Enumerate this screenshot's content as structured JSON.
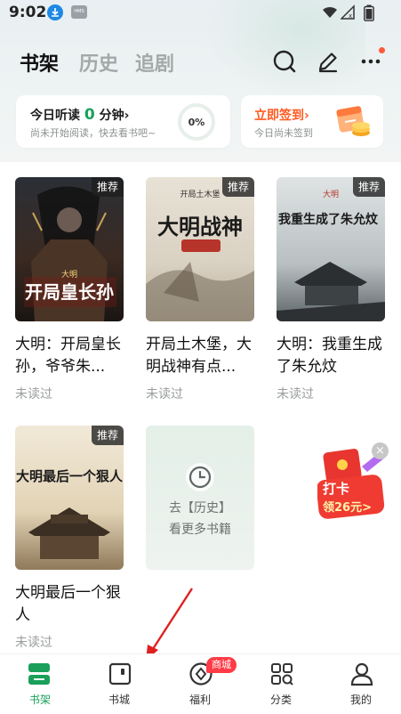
{
  "status_bar": {
    "time": "9:02",
    "hms_label": "HMS"
  },
  "header": {
    "tabs": [
      {
        "label": "书架",
        "active": true
      },
      {
        "label": "历史",
        "active": false
      },
      {
        "label": "追剧",
        "active": false
      }
    ],
    "icons": [
      "search-icon",
      "edit-icon",
      "more-icon"
    ]
  },
  "listen_card": {
    "title_prefix": "今日听读",
    "minutes": "0",
    "title_suffix": "分钟",
    "chevron": "›",
    "subtitle": "尚未开始阅读，快去看书吧~",
    "progress": "0%"
  },
  "sign_card": {
    "title": "立即签到",
    "chevron": "›",
    "subtitle": "今日尚未签到"
  },
  "books": [
    {
      "tag": "推荐",
      "title": "大明：开局皇长孙，爷爷朱...",
      "status": "未读过",
      "cover_text": "开局皇长孙",
      "cover_sub": "大明"
    },
    {
      "tag": "推荐",
      "title": "开局土木堡，大明战神有点...",
      "status": "未读过",
      "cover_text": "大明战神",
      "cover_sub": "开局土木堡"
    },
    {
      "tag": "推荐",
      "title": "大明：我重生成了朱允炆",
      "status": "未读过",
      "cover_text": "我重生成了朱允炆",
      "cover_sub": "大明"
    },
    {
      "tag": "推荐",
      "title": "大明最后一个狠人",
      "status": "未读过",
      "cover_text": "大明最后一个狠人",
      "cover_sub": ""
    }
  ],
  "history_card": {
    "line1": "去【历史】",
    "line2": "看更多书籍"
  },
  "checkin_float": {
    "label": "打卡",
    "amount": "领26元>",
    "close": "×"
  },
  "bottom_nav": [
    {
      "label": "书架",
      "icon": "bookshelf-icon",
      "active": true
    },
    {
      "label": "书城",
      "icon": "bookstore-icon",
      "active": false
    },
    {
      "label": "福利",
      "icon": "welfare-icon",
      "active": false
    },
    {
      "label": "分类",
      "icon": "category-icon",
      "active": false
    },
    {
      "label": "我的",
      "icon": "profile-icon",
      "active": false
    }
  ],
  "nav_badge": "商城",
  "colors": {
    "accent_green": "#1aa05a",
    "sign_orange": "#ff5a1f",
    "badge_red": "#ff3b45"
  }
}
